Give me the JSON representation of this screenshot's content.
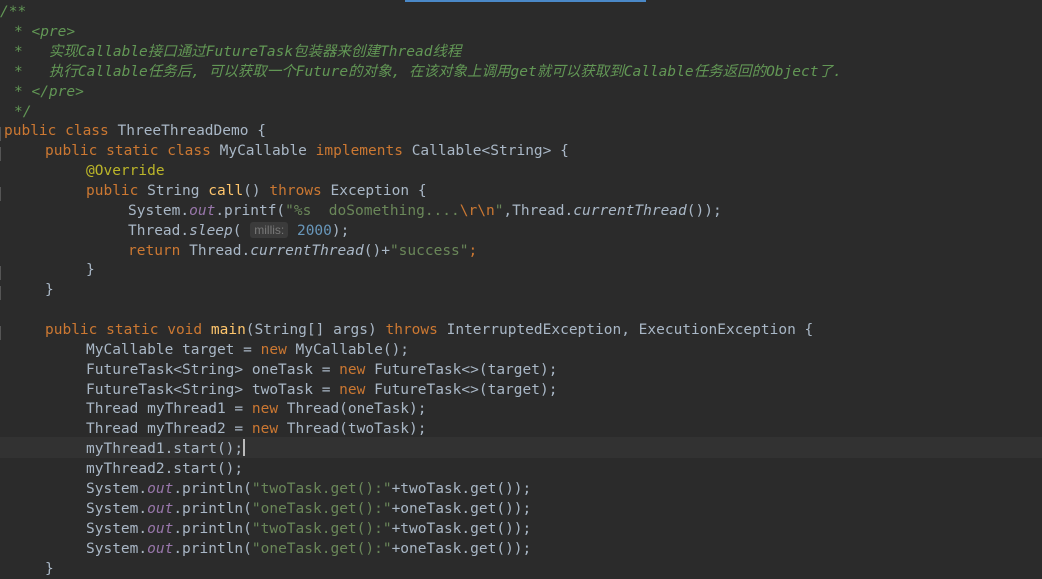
{
  "editor": {
    "comment": {
      "open": "/**",
      "pre_open": "<pre>",
      "line1": "实现Callable接口通过FutureTask包装器来创建Thread线程",
      "line2": "执行Callable任务后, 可以获取一个Future的对象, 在该对象上调用get就可以获取到Callable任务返回的Object了.",
      "pre_close": "</pre>",
      "close": "*/"
    },
    "class_decl": {
      "kw": "public class",
      "name": "ThreeThreadDemo",
      "brace": "{"
    },
    "inner_class": {
      "kw": "public static class",
      "name": "MyCallable",
      "implements": "implements",
      "iface": "Callable<String>",
      "brace": "{"
    },
    "override": "@Override",
    "call_decl": {
      "kw": "public",
      "type": "String",
      "name": "call",
      "parens": "()",
      "throws": "throws",
      "exc": "Exception",
      "brace": "{"
    },
    "printf_line": {
      "recv": "System.",
      "field": "out",
      "call": ".printf(",
      "str_a": "\"%s  doSomething....",
      "esc": "\\r\\n",
      "str_b": "\"",
      "rest_a": ",Thread.",
      "static_m": "currentThread",
      "rest_b": "());"
    },
    "sleep_line": {
      "recv": "Thread.",
      "static_m": "sleep",
      "open": "(",
      "hint": "millis:",
      "num": "2000",
      "close": ");"
    },
    "return_line": {
      "kw": "return",
      "recv": "Thread.",
      "static_m": "currentThread",
      "rest": "()+",
      "str": "\"success\"",
      "semi": ";"
    },
    "close_brace": "}",
    "main_decl": {
      "kw": "public static void",
      "name": "main",
      "params": "(String[] args)",
      "throws": "throws",
      "exc": "InterruptedException, ExecutionException",
      "brace": "{"
    },
    "body": {
      "l1_a": "MyCallable target = ",
      "l1_new": "new",
      "l1_b": " MyCallable();",
      "l2_a": "FutureTask<String> oneTask = ",
      "l2_new": "new",
      "l2_b": " FutureTask<>(target);",
      "l3_a": "FutureTask<String> twoTask = ",
      "l3_new": "new",
      "l3_b": " FutureTask<>(target);",
      "l4_a": "Thread myThread1 = ",
      "l4_new": "new",
      "l4_b": " Thread(oneTask);",
      "l5_a": "Thread myThread2 = ",
      "l5_new": "new",
      "l5_b": " Thread(twoTask);",
      "l6": "myThread1.start();",
      "l7": "myThread2.start();",
      "println": [
        {
          "recv": "System.",
          "field": "out",
          "call": ".println(",
          "str": "\"twoTask.get():\"",
          "rest": "+twoTask.get());"
        },
        {
          "recv": "System.",
          "field": "out",
          "call": ".println(",
          "str": "\"oneTask.get():\"",
          "rest": "+oneTask.get());"
        },
        {
          "recv": "System.",
          "field": "out",
          "call": ".println(",
          "str": "\"twoTask.get():\"",
          "rest": "+twoTask.get());"
        },
        {
          "recv": "System.",
          "field": "out",
          "call": ".println(",
          "str": "\"oneTask.get():\"",
          "rest": "+oneTask.get());"
        }
      ],
      "last_brace": "}"
    }
  }
}
